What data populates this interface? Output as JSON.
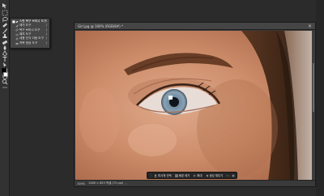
{
  "document": {
    "title": "Girl.jpg @ 100% (RGB/8#) *",
    "close": "×",
    "status_zoom": "100%",
    "status_text": "1280 × 853 픽셀 (72 ppi)",
    "status_arrow": "›"
  },
  "tools": [
    {
      "name": "move-tool-icon"
    },
    {
      "name": "marquee-tool-icon"
    },
    {
      "name": "lasso-tool-icon"
    },
    {
      "name": "magic-wand-tool-icon"
    },
    {
      "name": "crop-tool-icon"
    },
    {
      "name": "frame-tool-icon"
    },
    {
      "name": "eyedropper-tool-icon"
    },
    {
      "name": "healing-brush-tool-icon"
    },
    {
      "name": "brush-tool-icon"
    },
    {
      "name": "clone-stamp-tool-icon"
    },
    {
      "name": "history-brush-tool-icon"
    },
    {
      "name": "eraser-tool-icon"
    },
    {
      "name": "gradient-tool-icon"
    },
    {
      "name": "blur-tool-icon"
    },
    {
      "name": "dodge-tool-icon"
    },
    {
      "name": "pen-tool-icon"
    },
    {
      "name": "type-tool-icon"
    },
    {
      "name": "path-selection-tool-icon"
    },
    {
      "name": "rectangle-tool-icon"
    },
    {
      "name": "hand-tool-icon"
    },
    {
      "name": "zoom-tool-icon"
    },
    {
      "name": "more-tools-icon"
    }
  ],
  "flyout": {
    "items": [
      {
        "label": "스팟 복구 브러시 도구",
        "key": "J",
        "active": true,
        "check": "■"
      },
      {
        "label": "제거 도구",
        "key": "J",
        "active": false,
        "check": ""
      },
      {
        "label": "복구 브러시 도구",
        "key": "J",
        "active": false,
        "check": ""
      },
      {
        "label": "패치 도구",
        "key": "J",
        "active": false,
        "check": ""
      },
      {
        "label": "내용 인식 이동 도구",
        "key": "J",
        "active": false,
        "check": ""
      },
      {
        "label": "적목 현상 도구",
        "key": "J",
        "active": false,
        "check": ""
      }
    ]
  },
  "taskbar": {
    "grip": "⋮",
    "select_subject": "피사체 선택",
    "remove_bg": "배경 제거",
    "more": "확대",
    "generate": "생성 채우기",
    "icons": [
      "more-options-icon",
      "settings-icon"
    ]
  },
  "colors": {
    "foreground": "#000000",
    "background": "#ffffff",
    "accent": "#2680eb"
  }
}
